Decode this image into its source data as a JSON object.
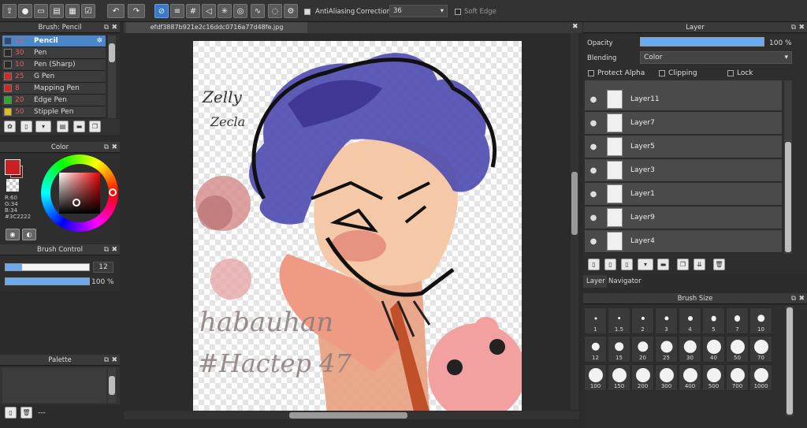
{
  "toolbar": {
    "antialiasing_label": "AntiAliasing",
    "correction_label": "Correction",
    "correction_value": "36",
    "soft_edge_label": "Soft Edge"
  },
  "doc_tab": {
    "title": "efdf3887b921e2c16ddc0716a77d48fe.jpg"
  },
  "brush_panel": {
    "title": "Brush: Pencil",
    "items": [
      {
        "size": "12",
        "name": "Pencil",
        "color": "#2a4a7a"
      },
      {
        "size": "30",
        "name": "Pen",
        "color": "#2a2a2a"
      },
      {
        "size": "10",
        "name": "Pen (Sharp)",
        "color": "#2a2a2a"
      },
      {
        "size": "25",
        "name": "G Pen",
        "color": "#cc2a2a"
      },
      {
        "size": "8",
        "name": "Mapping Pen",
        "color": "#cc2a2a"
      },
      {
        "size": "20",
        "name": "Edge Pen",
        "color": "#2aaa2a"
      },
      {
        "size": "50",
        "name": "Stipple Pen",
        "color": "#d8c020"
      }
    ]
  },
  "color_panel": {
    "title": "Color",
    "r": "R:60",
    "g": "G:34",
    "b": "B:34",
    "hex": "#3C2222",
    "main_color": "#cc1f1f"
  },
  "brush_control": {
    "title": "Brush Control",
    "size_value": "12",
    "opacity_value": "100 %",
    "size_fraction": 0.2,
    "opacity_fraction": 1.0
  },
  "palette": {
    "title": "Palette",
    "footer_text": "---"
  },
  "layer_panel": {
    "title": "Layer",
    "opacity_label": "Opacity",
    "opacity_value": "100 %",
    "blending_label": "Blending",
    "blending_value": "Color",
    "protect_alpha": "Protect Alpha",
    "clipping": "Clipping",
    "lock": "Lock",
    "layers": [
      "Layer11",
      "Layer7",
      "Layer5",
      "Layer3",
      "Layer1",
      "Layer9",
      "Layer4"
    ],
    "tabs": [
      "Layer",
      "Navigator"
    ]
  },
  "brush_size": {
    "title": "Brush Size",
    "sizes": [
      "1",
      "1.5",
      "2",
      "3",
      "4",
      "5",
      "7",
      "10",
      "12",
      "15",
      "20",
      "25",
      "30",
      "40",
      "50",
      "70",
      "100",
      "150",
      "200",
      "300",
      "400",
      "500",
      "700",
      "1000"
    ]
  },
  "canvas_text": {
    "signature_1": "Zelly",
    "signature_2": "Zecla",
    "handwriting_1": "habauhan",
    "handwriting_2": "#Hactep 47"
  }
}
